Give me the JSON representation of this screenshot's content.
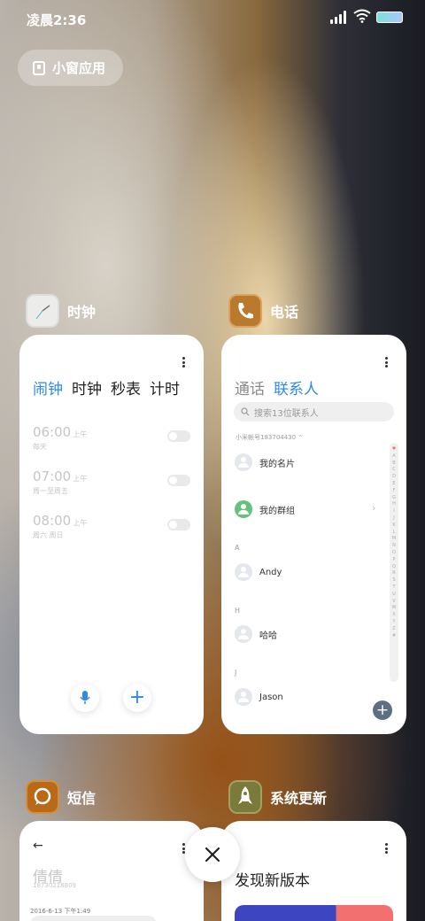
{
  "status_bar": {
    "time": "凌晨2:36"
  },
  "floating_window": {
    "label": "小窗应用"
  },
  "apps": {
    "clock": {
      "name": "时钟",
      "tabs": [
        "闹钟",
        "时钟",
        "秒表",
        "计时"
      ],
      "active_tab": "闹钟",
      "alarms": [
        {
          "time": "06:00",
          "ampm": "上午",
          "repeat": "每天",
          "enabled": false
        },
        {
          "time": "07:00",
          "ampm": "上午",
          "repeat": "周一至周五",
          "enabled": false
        },
        {
          "time": "08:00",
          "ampm": "上午",
          "repeat": "周六 周日",
          "enabled": false
        }
      ]
    },
    "phone": {
      "name": "电话",
      "tabs": [
        "通话",
        "联系人"
      ],
      "active_tab": "联系人",
      "search_placeholder": "搜索13位联系人",
      "account": "小米帐号183704430",
      "my_card": "我的名片",
      "my_groups": "我的群组",
      "sections": [
        {
          "letter": "A",
          "contact": "Andy"
        },
        {
          "letter": "H",
          "contact": "哈哈"
        },
        {
          "letter": "J",
          "contact": "Jason"
        }
      ],
      "index_letters": [
        "♥",
        "A",
        "B",
        "C",
        "D",
        "E",
        "F",
        "G",
        "H",
        "I",
        "J",
        "K",
        "L",
        "M",
        "N",
        "O",
        "P",
        "Q",
        "R",
        "S",
        "T",
        "U",
        "V",
        "W",
        "X",
        "Y",
        "Z",
        "#"
      ]
    },
    "sms": {
      "name": "短信",
      "contact_name": "倩倩",
      "contact_number": "18730218809",
      "date": "2016-6-13 下午1:49"
    },
    "update": {
      "name": "系统更新",
      "title": "发现新版本"
    }
  },
  "colors": {
    "accent": "#2f8ae6"
  }
}
